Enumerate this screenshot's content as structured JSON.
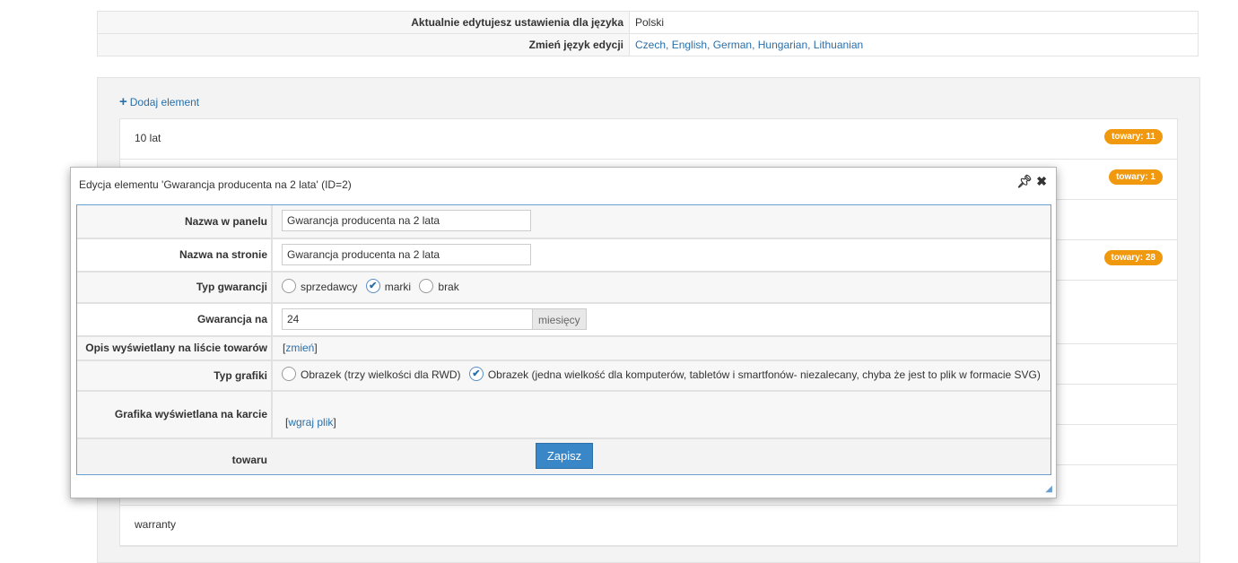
{
  "language": {
    "current_label": "Aktualnie edytujesz ustawienia dla języka",
    "current_value": "Polski",
    "change_label": "Zmień język edycji",
    "options": [
      "Czech",
      "English",
      "German",
      "Hungarian",
      "Lithuanian"
    ]
  },
  "panel": {
    "add_label": "Dodaj element",
    "rows": [
      {
        "text": "10 lat",
        "badge": "towary: 11"
      },
      {
        "text": "",
        "badge": "towary: 1"
      },
      {
        "text": "",
        "badge": ""
      },
      {
        "text": "",
        "badge": "towary: 28"
      },
      {
        "text": "",
        "badge": ""
      },
      {
        "text": "",
        "badge": ""
      },
      {
        "text": "",
        "badge": ""
      },
      {
        "text": "",
        "badge": ""
      },
      {
        "text": "",
        "badge": ""
      },
      {
        "text": "warranty",
        "badge": ""
      }
    ]
  },
  "dialog": {
    "title": "Edycja elementu 'Gwarancja producenta na 2 lata' (ID=2)",
    "icons": [
      "pin-icon",
      "close-icon"
    ],
    "fields": {
      "panel_name_label": "Nazwa w panelu",
      "panel_name_value": "Gwarancja producenta na 2 lata",
      "page_name_label": "Nazwa na stronie",
      "page_name_value": "Gwarancja producenta na 2 lata",
      "warranty_type_label": "Typ gwarancji",
      "warranty_type_options": [
        "sprzedawcy",
        "marki",
        "brak"
      ],
      "warranty_type_selected": "marki",
      "warranty_label": "Gwarancja na",
      "warranty_value": "24",
      "warranty_unit": "miesięcy",
      "desc_label": "Opis wyświetlany na liście towarów",
      "desc_link": "zmień",
      "graphic_type_label": "Typ grafiki",
      "graphic_type_options": [
        "Obrazek (trzy wielkości dla RWD)",
        "Obrazek (jedna wielkość dla komputerów, tabletów i smartfonów- niezalecany, chyba że jest to plik w formacie SVG)"
      ],
      "graphic_type_selected": 1,
      "graphic_card_label": "Grafika wyświetlana na karcie towaru",
      "upload_link": "wgraj plik"
    },
    "save_label": "Zapisz"
  },
  "colors": {
    "badge": "#f0980e",
    "link": "#2a6fa8",
    "button": "#3a87c8"
  }
}
